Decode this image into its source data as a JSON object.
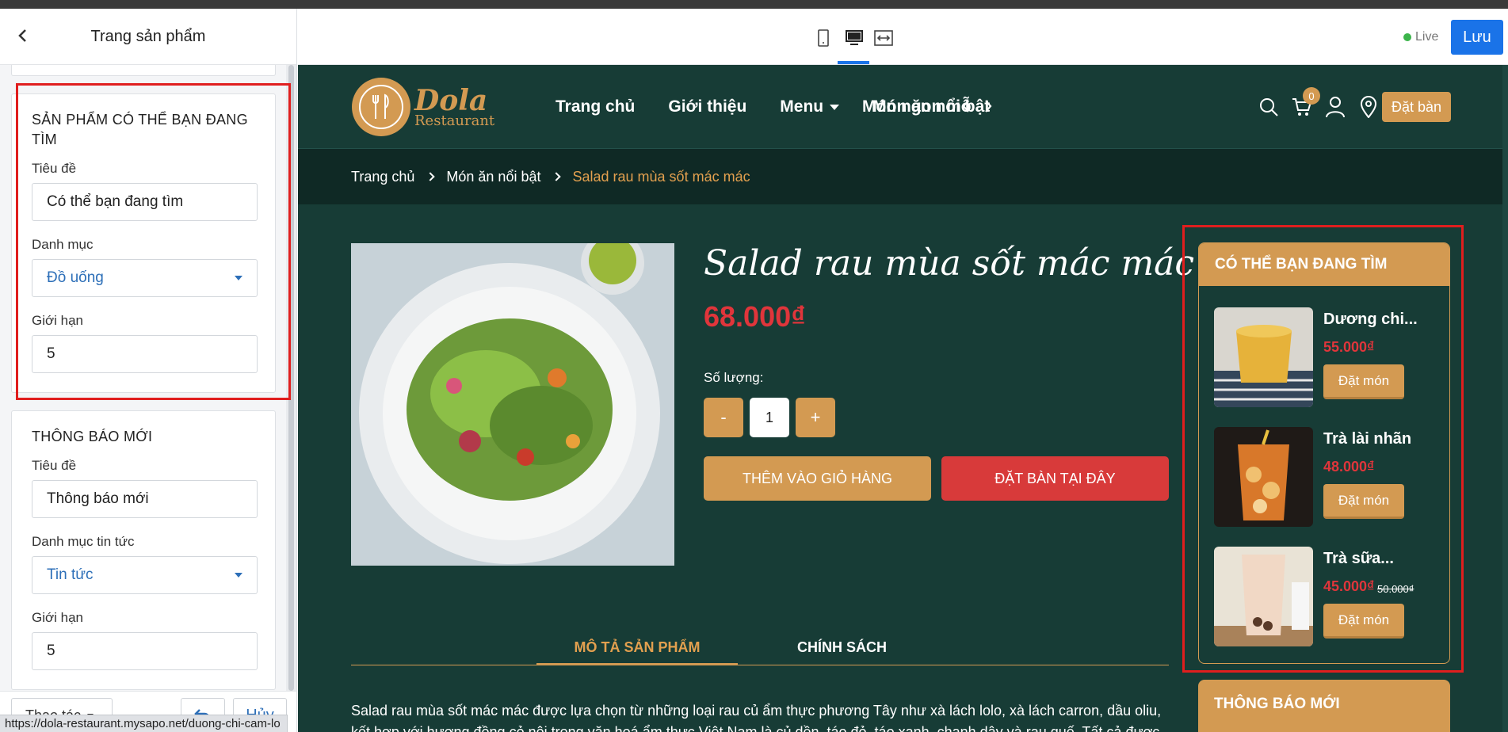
{
  "editor": {
    "title": "Trang sản phẩm",
    "section1": {
      "heading": "SẢN PHẨM CÓ THỂ BẠN ĐANG TÌM",
      "title_label": "Tiêu đề",
      "title_value": "Có thể bạn đang tìm",
      "category_label": "Danh mục",
      "category_value": "Đồ uống",
      "limit_label": "Giới hạn",
      "limit_value": "5"
    },
    "section2": {
      "heading": "THÔNG BÁO MỚI",
      "title_label": "Tiêu đề",
      "title_value": "Thông báo mới",
      "category_label": "Danh mục tin tức",
      "category_value": "Tin tức",
      "limit_label": "Giới hạn",
      "limit_value": "5"
    },
    "footer": {
      "actions_label": "Thao tác",
      "cancel_label": "Hủy"
    },
    "status_url": "https://dola-restaurant.mysapo.net/duong-chi-cam-lo"
  },
  "toolbar": {
    "live_label": "Live",
    "live_color": "#3cb44b",
    "save_label": "Lưu",
    "accent": "#1a73e8"
  },
  "site": {
    "logo": {
      "line1": "Dola",
      "line2": "Restaurant"
    },
    "menu": {
      "home": "Trang chủ",
      "about": "Giới thiệu",
      "menu": "Menu",
      "featured": "Món ăn nổi bật",
      "tasty": "Món ngon mỗ"
    },
    "cart_count": "0",
    "book_button": "Đặt bàn",
    "breadcrumb": {
      "home": "Trang chủ",
      "category": "Món ăn nổi bật",
      "current": "Salad rau mùa sốt mác mác"
    },
    "product": {
      "name": "Salad rau mùa sốt mác mác",
      "price": "68.000₫",
      "qty_label": "Số lượng:",
      "minus": "-",
      "qty": "1",
      "plus": "+",
      "add_to_cart": "THÊM VÀO GIỎ HÀNG",
      "book_here": "ĐẶT BÀN TẠI ĐÂY"
    },
    "tabs": {
      "description": "MÔ TẢ SẢN PHẨM",
      "policy": "CHÍNH SÁCH"
    },
    "description_text": "Salad rau mùa sốt mác mác được lựa chọn từ những loại rau củ ẩm thực phương Tây như xà lách lolo, xà lách carron, dầu oliu, kết hợp với hương đồng cỏ nội trong văn hoá ẩm thực Việt Nam là củ dền, táo đỏ, táo xanh, chanh dây và rau quế. Tất cả được hòa",
    "sidebar": {
      "heading": "CÓ THỂ BẠN ĐANG TÌM",
      "items": [
        {
          "name": "Dương chi...",
          "price": "55.000₫",
          "old_price": "",
          "order": "Đặt món"
        },
        {
          "name": "Trà lài nhãn",
          "price": "48.000₫",
          "old_price": "",
          "order": "Đặt món"
        },
        {
          "name": "Trà sữa...",
          "price": "45.000₫",
          "old_price": "50.000₫",
          "order": "Đặt món"
        }
      ]
    },
    "news_heading": "THÔNG BÁO MỚI",
    "colors": {
      "bg": "#173c36",
      "gold": "#d39a52",
      "red": "#d83a3a",
      "price_red": "#e0353b"
    }
  }
}
